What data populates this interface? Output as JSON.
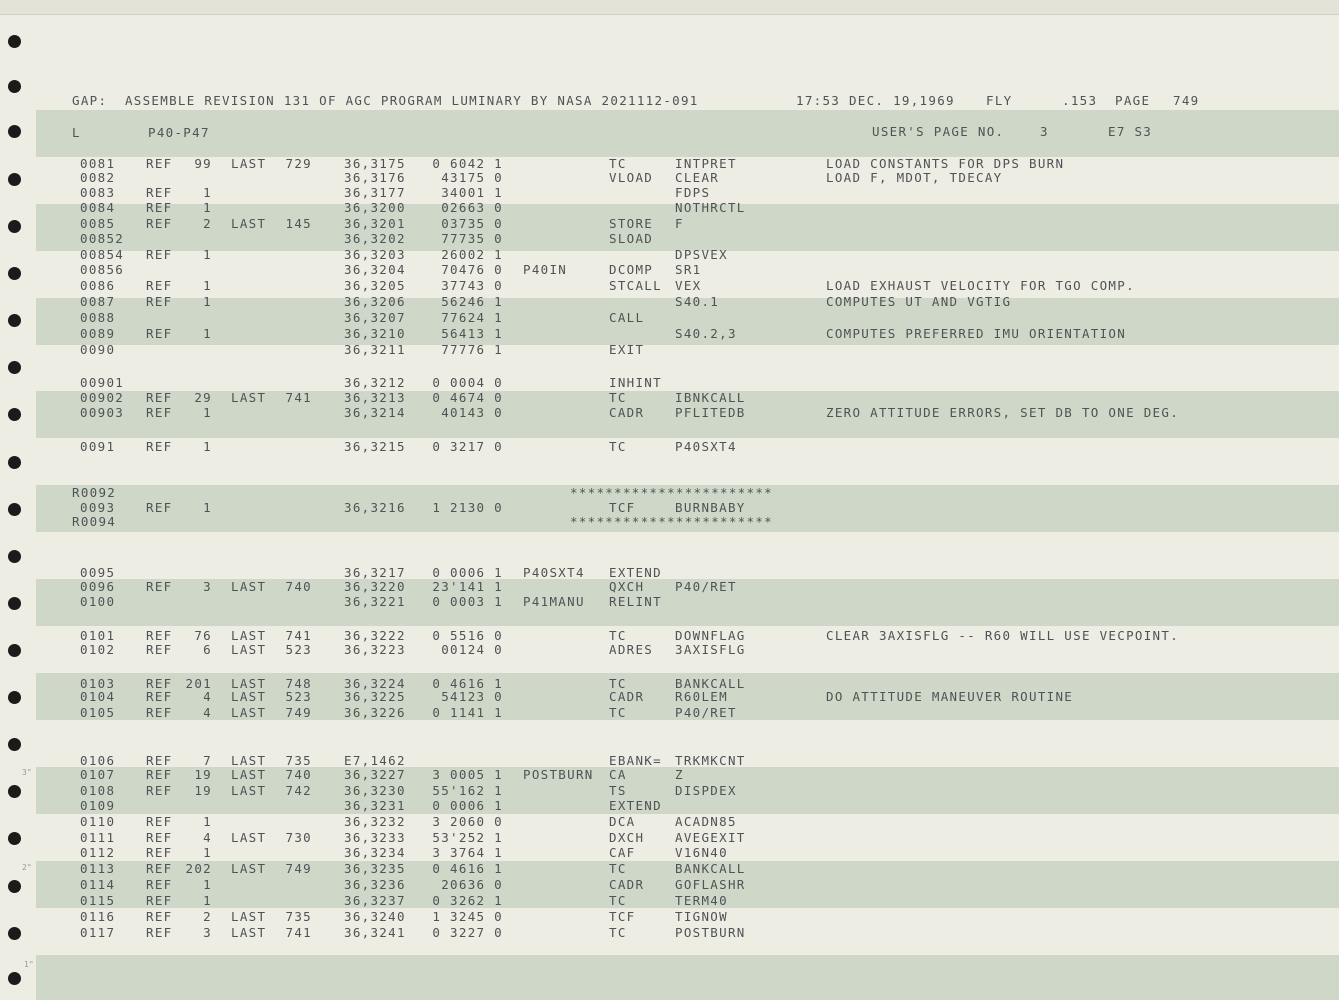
{
  "header": {
    "title": "GAP:  ASSEMBLE REVISION 131 OF AGC PROGRAM LUMINARY BY NASA 2021112-091",
    "time": "17:53 DEC. 19,1969",
    "fly": "FLY",
    "seq": ".153",
    "page_label": "PAGE",
    "page_num": "749"
  },
  "subheader": {
    "left": "L",
    "section": "P40-P47",
    "users_page": "USER'S PAGE NO.",
    "users_page_num": "3",
    "code": "E7 S3"
  },
  "margin_marks": [
    "3\"",
    "2\"",
    "1\""
  ],
  "lines": [
    {
      "seq": "0081",
      "ref": "REF",
      "refn": "99",
      "last": "LAST",
      "lastn": "729",
      "addr": "36,3175",
      "word": "0 6042 1",
      "label": "",
      "op": "TC",
      "operand": "INTPRET",
      "comment": "LOAD CONSTANTS FOR DPS BURN"
    },
    {
      "seq": "0082",
      "ref": "",
      "refn": "",
      "last": "",
      "lastn": "",
      "addr": "36,3176",
      "word": "43175 0",
      "label": "",
      "op": "VLOAD",
      "operand": "CLEAR",
      "comment": "LOAD F, MDOT, TDECAY"
    },
    {
      "seq": "0083",
      "ref": "REF",
      "refn": "1",
      "last": "",
      "lastn": "",
      "addr": "36,3177",
      "word": "34001 1",
      "label": "",
      "op": "",
      "operand": "FDPS",
      "comment": ""
    },
    {
      "seq": "0084",
      "ref": "REF",
      "refn": "1",
      "last": "",
      "lastn": "",
      "addr": "36,3200",
      "word": "02663 0",
      "label": "",
      "op": "",
      "operand": "NOTHRCTL",
      "comment": ""
    },
    {
      "seq": "0085",
      "ref": "REF",
      "refn": "2",
      "last": "LAST",
      "lastn": "145",
      "addr": "36,3201",
      "word": "03735 0",
      "label": "",
      "op": "STORE",
      "operand": "F",
      "comment": ""
    },
    {
      "seq": "00852",
      "ref": "",
      "refn": "",
      "last": "",
      "lastn": "",
      "addr": "36,3202",
      "word": "77735 0",
      "label": "",
      "op": "SLOAD",
      "operand": "",
      "comment": ""
    },
    {
      "seq": "00854",
      "ref": "REF",
      "refn": "1",
      "last": "",
      "lastn": "",
      "addr": "36,3203",
      "word": "26002 1",
      "label": "",
      "op": "",
      "operand": "DPSVEX",
      "comment": ""
    },
    {
      "seq": "00856",
      "ref": "",
      "refn": "",
      "last": "",
      "lastn": "",
      "addr": "36,3204",
      "word": "70476 0",
      "label": "P40IN",
      "op": "DCOMP",
      "operand": "SR1",
      "comment": ""
    },
    {
      "seq": "0086",
      "ref": "REF",
      "refn": "1",
      "last": "",
      "lastn": "",
      "addr": "36,3205",
      "word": "37743 0",
      "label": "",
      "op": "STCALL",
      "operand": "VEX",
      "comment": "LOAD EXHAUST VELOCITY FOR TGO COMP."
    },
    {
      "seq": "0087",
      "ref": "REF",
      "refn": "1",
      "last": "",
      "lastn": "",
      "addr": "36,3206",
      "word": "56246 1",
      "label": "",
      "op": "",
      "operand": "S40.1",
      "comment": "COMPUTES UT AND VGTIG"
    },
    {
      "seq": "0088",
      "ref": "",
      "refn": "",
      "last": "",
      "lastn": "",
      "addr": "36,3207",
      "word": "77624 1",
      "label": "",
      "op": "CALL",
      "operand": "",
      "comment": ""
    },
    {
      "seq": "0089",
      "ref": "REF",
      "refn": "1",
      "last": "",
      "lastn": "",
      "addr": "36,3210",
      "word": "56413 1",
      "label": "",
      "op": "",
      "operand": "S40.2,3",
      "comment": "COMPUTES PREFERRED IMU ORIENTATION"
    },
    {
      "seq": "0090",
      "ref": "",
      "refn": "",
      "last": "",
      "lastn": "",
      "addr": "36,3211",
      "word": "77776 1",
      "label": "",
      "op": "EXIT",
      "operand": "",
      "comment": ""
    },
    {
      "seq": "00901",
      "ref": "",
      "refn": "",
      "last": "",
      "lastn": "",
      "addr": "36,3212",
      "word": "0 0004 0",
      "label": "",
      "op": "INHINT",
      "operand": "",
      "comment": ""
    },
    {
      "seq": "00902",
      "ref": "REF",
      "refn": "29",
      "last": "LAST",
      "lastn": "741",
      "addr": "36,3213",
      "word": "0 4674 0",
      "label": "",
      "op": "TC",
      "operand": "IBNKCALL",
      "comment": ""
    },
    {
      "seq": "00903",
      "ref": "REF",
      "refn": "1",
      "last": "",
      "lastn": "",
      "addr": "36,3214",
      "word": "40143 0",
      "label": "",
      "op": "CADR",
      "operand": "PFLITEDB",
      "comment": "ZERO ATTITUDE ERRORS, SET DB TO ONE DEG."
    },
    {
      "seq": "0091",
      "ref": "REF",
      "refn": "1",
      "last": "",
      "lastn": "",
      "addr": "36,3215",
      "word": "0 3217 0",
      "label": "",
      "op": "TC",
      "operand": "P40SXT4",
      "comment": ""
    },
    {
      "seq": "R0092",
      "ref": "",
      "refn": "",
      "last": "",
      "lastn": "",
      "addr": "",
      "word": "",
      "label": "",
      "op": "",
      "operand": "",
      "comment": "",
      "stars": "***********************"
    },
    {
      "seq": "0093",
      "ref": "REF",
      "refn": "1",
      "last": "",
      "lastn": "",
      "addr": "36,3216",
      "word": "1 2130 0",
      "label": "",
      "op": "TCF",
      "operand": "BURNBABY",
      "comment": ""
    },
    {
      "seq": "R0094",
      "ref": "",
      "refn": "",
      "last": "",
      "lastn": "",
      "addr": "",
      "word": "",
      "label": "",
      "op": "",
      "operand": "",
      "comment": "",
      "stars": "***********************"
    },
    {
      "seq": "0095",
      "ref": "",
      "refn": "",
      "last": "",
      "lastn": "",
      "addr": "36,3217",
      "word": "0 0006 1",
      "label": "P40SXT4",
      "op": "EXTEND",
      "operand": "",
      "comment": ""
    },
    {
      "seq": "0096",
      "ref": "REF",
      "refn": "3",
      "last": "LAST",
      "lastn": "740",
      "addr": "36,3220",
      "word": "23'141 1",
      "label": "",
      "op": "QXCH",
      "operand": "P40/RET",
      "comment": ""
    },
    {
      "seq": "0100",
      "ref": "",
      "refn": "",
      "last": "",
      "lastn": "",
      "addr": "36,3221",
      "word": "0 0003 1",
      "label": "P41MANU",
      "op": "RELINT",
      "operand": "",
      "comment": ""
    },
    {
      "seq": "0101",
      "ref": "REF",
      "refn": "76",
      "last": "LAST",
      "lastn": "741",
      "addr": "36,3222",
      "word": "0 5516 0",
      "label": "",
      "op": "TC",
      "operand": "DOWNFLAG",
      "comment": "CLEAR 3AXISFLG -- R60 WILL USE VECPOINT."
    },
    {
      "seq": "0102",
      "ref": "REF",
      "refn": "6",
      "last": "LAST",
      "lastn": "523",
      "addr": "36,3223",
      "word": "00124 0",
      "label": "",
      "op": "ADRES",
      "operand": "3AXISFLG",
      "comment": ""
    },
    {
      "seq": "0103",
      "ref": "REF",
      "refn": "201",
      "last": "LAST",
      "lastn": "748",
      "addr": "36,3224",
      "word": "0 4616 1",
      "label": "",
      "op": "TC",
      "operand": "BANKCALL",
      "comment": ""
    },
    {
      "seq": "0104",
      "ref": "REF",
      "refn": "4",
      "last": "LAST",
      "lastn": "523",
      "addr": "36,3225",
      "word": "54123 0",
      "label": "",
      "op": "CADR",
      "operand": "R60LEM",
      "comment": "DO ATTITUDE MANEUVER ROUTINE"
    },
    {
      "seq": "0105",
      "ref": "REF",
      "refn": "4",
      "last": "LAST",
      "lastn": "749",
      "addr": "36,3226",
      "word": "0 1141 1",
      "label": "",
      "op": "TC",
      "operand": "P40/RET",
      "comment": ""
    },
    {
      "seq": "0106",
      "ref": "REF",
      "refn": "7",
      "last": "LAST",
      "lastn": "735",
      "addr": "E7,1462",
      "word": "",
      "label": "",
      "op": "EBANK=",
      "operand": "TRKMKCNT",
      "comment": ""
    },
    {
      "seq": "0107",
      "ref": "REF",
      "refn": "19",
      "last": "LAST",
      "lastn": "740",
      "addr": "36,3227",
      "word": "3 0005 1",
      "label": "POSTBURN",
      "op": "CA",
      "operand": "Z",
      "comment": ""
    },
    {
      "seq": "0108",
      "ref": "REF",
      "refn": "19",
      "last": "LAST",
      "lastn": "742",
      "addr": "36,3230",
      "word": "55'162 1",
      "label": "",
      "op": "TS",
      "operand": "DISPDEX",
      "comment": ""
    },
    {
      "seq": "0109",
      "ref": "",
      "refn": "",
      "last": "",
      "lastn": "",
      "addr": "36,3231",
      "word": "0 0006 1",
      "label": "",
      "op": "EXTEND",
      "operand": "",
      "comment": ""
    },
    {
      "seq": "0110",
      "ref": "REF",
      "refn": "1",
      "last": "",
      "lastn": "",
      "addr": "36,3232",
      "word": "3 2060 0",
      "label": "",
      "op": "DCA",
      "operand": "ACADN85",
      "comment": ""
    },
    {
      "seq": "0111",
      "ref": "REF",
      "refn": "4",
      "last": "LAST",
      "lastn": "730",
      "addr": "36,3233",
      "word": "53'252 1",
      "label": "",
      "op": "DXCH",
      "operand": "AVEGEXIT",
      "comment": ""
    },
    {
      "seq": "0112",
      "ref": "REF",
      "refn": "1",
      "last": "",
      "lastn": "",
      "addr": "36,3234",
      "word": "3 3764 1",
      "label": "",
      "op": "CAF",
      "operand": "V16N40",
      "comment": ""
    },
    {
      "seq": "0113",
      "ref": "REF",
      "refn": "202",
      "last": "LAST",
      "lastn": "749",
      "addr": "36,3235",
      "word": "0 4616 1",
      "label": "",
      "op": "TC",
      "operand": "BANKCALL",
      "comment": ""
    },
    {
      "seq": "0114",
      "ref": "REF",
      "refn": "1",
      "last": "",
      "lastn": "",
      "addr": "36,3236",
      "word": "20636 0",
      "label": "",
      "op": "CADR",
      "operand": "GOFLASHR",
      "comment": ""
    },
    {
      "seq": "0115",
      "ref": "REF",
      "refn": "1",
      "last": "",
      "lastn": "",
      "addr": "36,3237",
      "word": "0 3262 1",
      "label": "",
      "op": "TC",
      "operand": "TERM40",
      "comment": ""
    },
    {
      "seq": "0116",
      "ref": "REF",
      "refn": "2",
      "last": "LAST",
      "lastn": "735",
      "addr": "36,3240",
      "word": "1 3245 0",
      "label": "",
      "op": "TCF",
      "operand": "TIGNOW",
      "comment": ""
    },
    {
      "seq": "0117",
      "ref": "REF",
      "refn": "3",
      "last": "LAST",
      "lastn": "741",
      "addr": "36,3241",
      "word": "0 3227 0",
      "label": "",
      "op": "TC",
      "operand": "POSTBURN",
      "comment": ""
    }
  ]
}
